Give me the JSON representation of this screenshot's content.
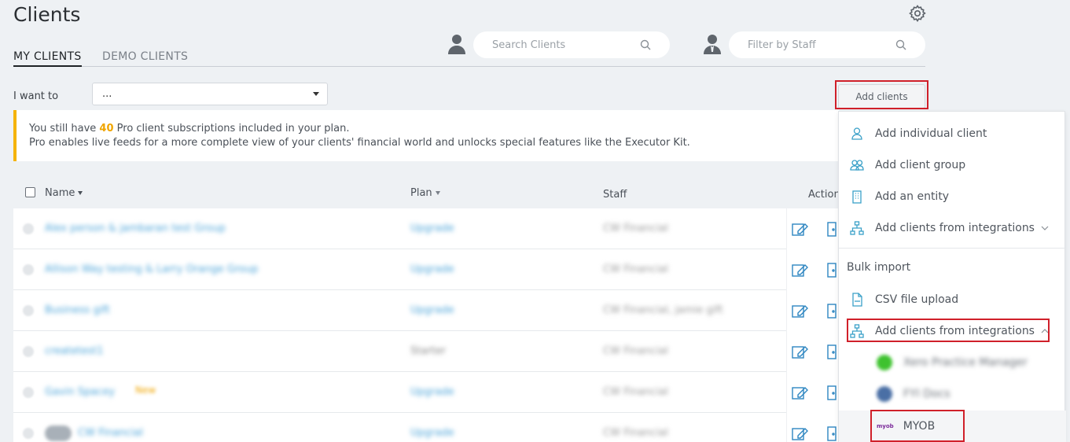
{
  "page": {
    "title": "Clients"
  },
  "tabs": {
    "my_clients": "MY CLIENTS",
    "demo_clients": "DEMO CLIENTS"
  },
  "search": {
    "placeholder": "Search Clients"
  },
  "filter": {
    "placeholder": "Filter by Staff"
  },
  "action_bar": {
    "label": "I want to",
    "select_value": "...",
    "add_button": "Add clients"
  },
  "banner": {
    "line1_prefix": "You still have ",
    "line1_count": "40",
    "line1_suffix": " Pro client subscriptions included in your plan.",
    "line2": "Pro enables live feeds for a more complete view of your clients' financial world and unlocks special features like the Executor Kit."
  },
  "table": {
    "columns": {
      "name": "Name",
      "plan": "Plan",
      "staff": "Staff",
      "actions": "Actions"
    },
    "rows": [
      {
        "name": "Alex person & jambaran test Group",
        "plan": "Upgrade",
        "staff": "CW Financial"
      },
      {
        "name": "Allison Way testing & Larry Orange Group",
        "plan": "Upgrade",
        "staff": "CW Financial"
      },
      {
        "name": "Business gift",
        "plan": "Upgrade",
        "staff": "CW Financial, jamie gift"
      },
      {
        "name": "createtest1",
        "plan": "Starter",
        "staff": "CW Financial"
      },
      {
        "name": "Gavin Spacey",
        "plan": "Upgrade",
        "staff": "CW Financial",
        "badge": "New"
      },
      {
        "name": "CW Financial",
        "plan": "Upgrade",
        "staff": "CW Financial"
      }
    ]
  },
  "dropdown": {
    "items": [
      {
        "label": "Add individual client",
        "icon": "person-icon"
      },
      {
        "label": "Add client group",
        "icon": "group-icon"
      },
      {
        "label": "Add an entity",
        "icon": "building-icon"
      },
      {
        "label": "Add clients from integrations",
        "icon": "hierarchy-icon"
      }
    ],
    "bulk_label": "Bulk import",
    "csv_label": "CSV file upload",
    "integrations_label": "Add clients from integrations",
    "integrations": [
      {
        "label": "Xero Practice Manager",
        "color": "#3ec22f"
      },
      {
        "label": "FYI Docs",
        "color": "#4a6fa5"
      },
      {
        "label": "MYOB",
        "logo": "myob"
      }
    ]
  },
  "colors": {
    "accent": "#4aa3d8",
    "highlight": "#f0a500",
    "annotation": "#d0202a"
  }
}
